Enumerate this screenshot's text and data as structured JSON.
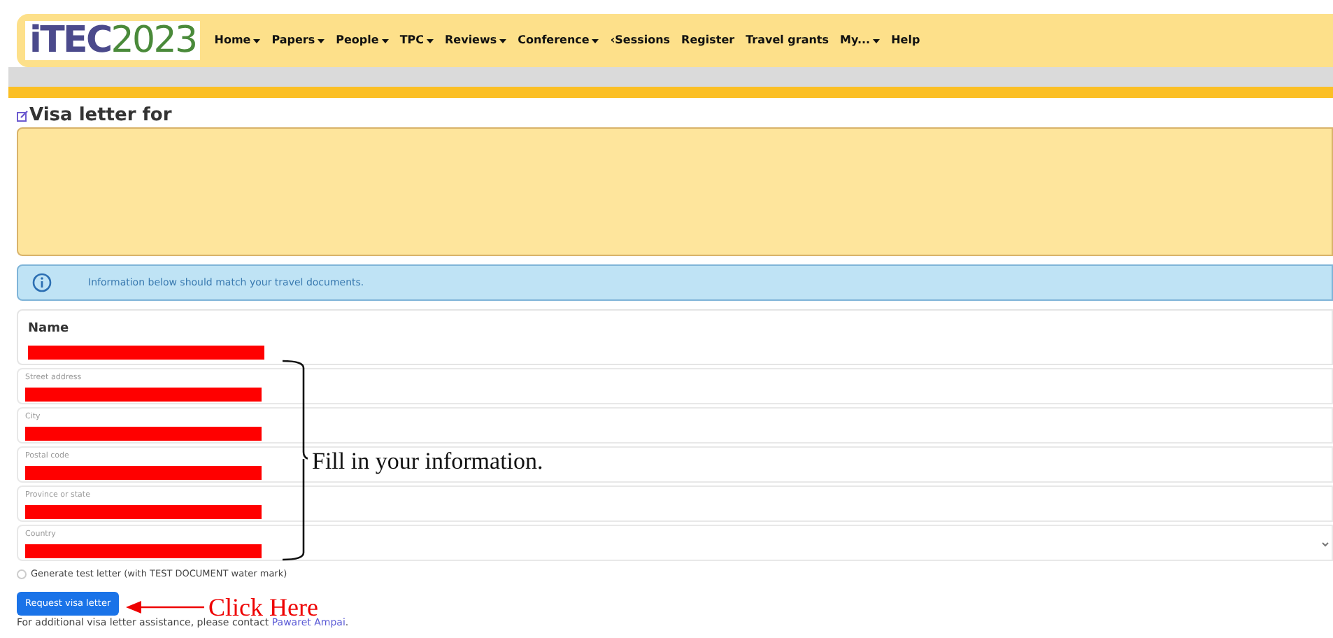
{
  "logo": {
    "prefix": "iTEC",
    "year": "2023"
  },
  "nav": [
    {
      "label": "Home",
      "dropdown": true
    },
    {
      "label": "Papers",
      "dropdown": true
    },
    {
      "label": "People",
      "dropdown": true
    },
    {
      "label": "TPC",
      "dropdown": true
    },
    {
      "label": "Reviews",
      "dropdown": true
    },
    {
      "label": "Conference",
      "dropdown": true
    },
    {
      "label": "‹Sessions",
      "dropdown": false
    },
    {
      "label": "Register",
      "dropdown": false
    },
    {
      "label": "Travel grants",
      "dropdown": false
    },
    {
      "label": "My...",
      "dropdown": true
    },
    {
      "label": "Help",
      "dropdown": false
    }
  ],
  "page_title": "Visa letter for",
  "alert": "Information below should match your travel documents.",
  "name_label": "Name",
  "fields": [
    {
      "label": "Street address",
      "kind": "text"
    },
    {
      "label": "City",
      "kind": "text"
    },
    {
      "label": "Postal code",
      "kind": "text"
    },
    {
      "label": "Province or state",
      "kind": "text"
    },
    {
      "label": "Country",
      "kind": "select"
    }
  ],
  "test_letter": {
    "label": "Generate test letter (with TEST DOCUMENT water mark)",
    "checked": false
  },
  "submit_button": "Request visa letter",
  "footer": {
    "text": "For additional visa letter assistance, please contact ",
    "link": "Pawaret Ampai",
    "end": "."
  },
  "annotations": {
    "bracket_note": "Fill in your information.",
    "arrow_note": "Click Here"
  }
}
